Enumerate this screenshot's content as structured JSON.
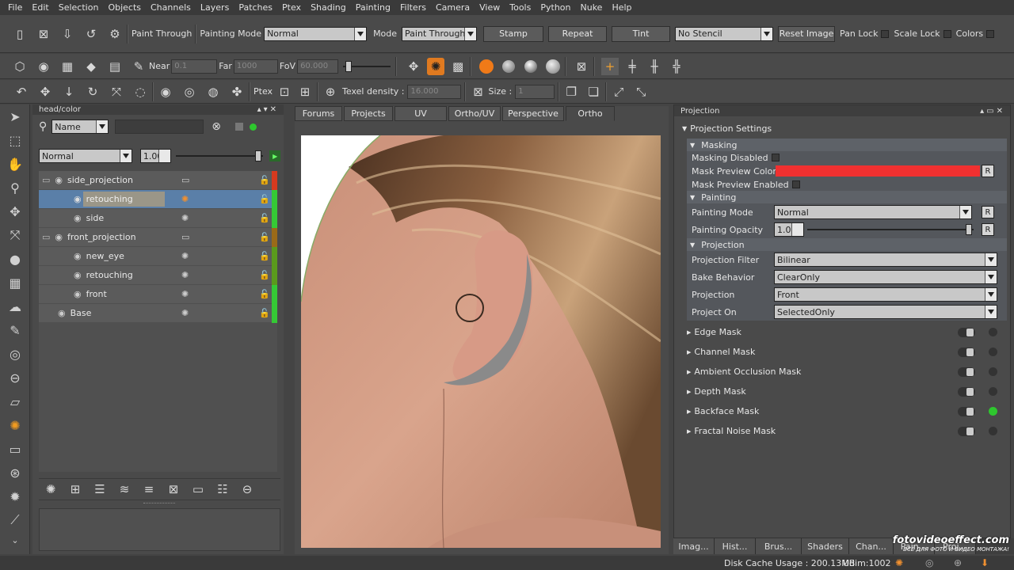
{
  "menu": [
    "File",
    "Edit",
    "Selection",
    "Objects",
    "Channels",
    "Layers",
    "Patches",
    "Ptex",
    "Shading",
    "Painting",
    "Filters",
    "Camera",
    "View",
    "Tools",
    "Python",
    "Nuke",
    "Help"
  ],
  "toolbar1": {
    "paint_through": "Paint Through",
    "painting_mode_label": "Painting Mode",
    "painting_mode_value": "Normal",
    "mode_label": "Mode",
    "mode_value": "Paint Through",
    "stamp": "Stamp",
    "repeat": "Repeat",
    "tint": "Tint",
    "stencil_value": "No Stencil",
    "reset_image": "Reset Image",
    "pan_lock": "Pan Lock",
    "scale_lock": "Scale Lock",
    "colors": "Colors"
  },
  "toolbar2": {
    "near_label": "Near",
    "near_value": "0.1",
    "far_label": "Far",
    "far_value": "1000",
    "fov_label": "FoV",
    "fov_value": "60.000"
  },
  "toolbar3": {
    "ptex_label": "Ptex",
    "texel_label": "Texel density :",
    "texel_value": "16.000",
    "size_label": "Size :",
    "size_value": "1"
  },
  "layers_panel": {
    "title": "head/color",
    "filter_value": "Name",
    "blend_value": "Normal",
    "opacity_value": "1.000",
    "rows": [
      {
        "name": "side_projection",
        "type": "group",
        "strip": "#d73a1f"
      },
      {
        "name": "retouching",
        "type": "layer",
        "strip": "#35c935",
        "selected": true
      },
      {
        "name": "side",
        "type": "layer",
        "strip": "#35c935"
      },
      {
        "name": "front_projection",
        "type": "group",
        "strip": "#9a6a18"
      },
      {
        "name": "new_eye",
        "type": "layer",
        "strip": "#5a9a1c"
      },
      {
        "name": "retouching",
        "type": "layer",
        "strip": "#5a9a1c"
      },
      {
        "name": "front",
        "type": "layer",
        "strip": "#35c935"
      },
      {
        "name": "Base",
        "type": "base",
        "strip": "#35c935"
      }
    ]
  },
  "viewport": {
    "tabs": [
      "Forums",
      "Projects",
      "UV",
      "Ortho/UV",
      "Perspective",
      "Ortho"
    ],
    "active_tab": "Ortho"
  },
  "projection_panel": {
    "title": "Projection",
    "settings_title": "Projection Settings",
    "masking": {
      "header": "Masking",
      "masking_disabled": "Masking Disabled",
      "mask_preview_color": "Mask Preview Color",
      "mask_color": "#f03030",
      "mask_preview_enabled": "Mask Preview Enabled"
    },
    "painting": {
      "header": "Painting",
      "painting_mode": "Painting Mode",
      "painting_mode_value": "Normal",
      "painting_opacity": "Painting Opacity",
      "painting_opacity_value": "1.000"
    },
    "projection": {
      "header": "Projection",
      "filter_label": "Projection Filter",
      "filter_value": "Bilinear",
      "bake_label": "Bake Behavior",
      "bake_value": "ClearOnly",
      "projection_label": "Projection",
      "projection_value": "Front",
      "project_on_label": "Project On",
      "project_on_value": "SelectedOnly"
    },
    "reset": "R",
    "masks": [
      "Edge Mask",
      "Channel Mask",
      "Ambient Occlusion Mask",
      "Depth Mask",
      "Backface Mask",
      "Fractal Noise Mask"
    ]
  },
  "bottom_tabs": [
    "Imag...",
    "Hist...",
    "Brus...",
    "Shaders",
    "Chan...",
    "Pain...",
    "Proj..."
  ],
  "status": {
    "disk_cache": "Disk Cache Usage : 200.13MB",
    "udim": "Udim:1002"
  },
  "watermark": {
    "main": "fotovideoeffect.com",
    "sub": "ВСЁ ДЛЯ ФОТО И ВИДЕО МОНТАЖА!"
  }
}
